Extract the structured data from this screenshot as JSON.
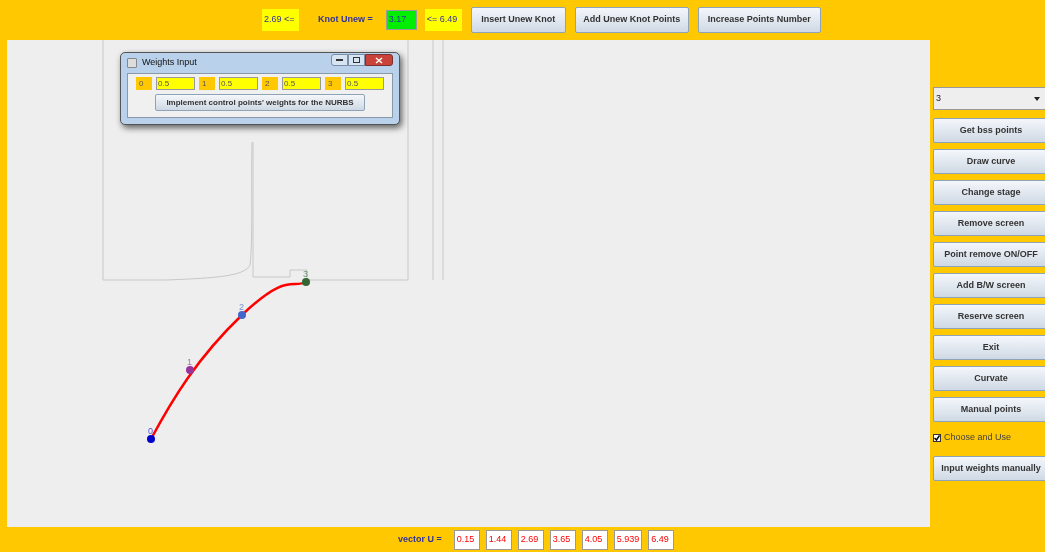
{
  "top_bar": {
    "lower_bound": "2.69 <=",
    "knot_label": "Knot Unew =",
    "knot_value": "3.17",
    "upper_bound": "<= 6.49",
    "buttons": [
      "Insert Unew Knot",
      "Add Unew Knot Points",
      "Increase Points Number"
    ]
  },
  "dialog": {
    "title": "Weights Input",
    "weights": [
      {
        "index": "0",
        "value": "0.5"
      },
      {
        "index": "1",
        "value": "0.5"
      },
      {
        "index": "2",
        "value": "0.5"
      },
      {
        "index": "3",
        "value": "0.5"
      }
    ],
    "button": "Implement control points' weights for the NURBS"
  },
  "canvas": {
    "points": [
      {
        "label": "0",
        "color": "#0000cc"
      },
      {
        "label": "1",
        "color": "#993399"
      },
      {
        "label": "2",
        "color": "#4466cc"
      },
      {
        "label": "3",
        "color": "#336633"
      }
    ]
  },
  "side_panel": {
    "dropdown": {
      "value": "3"
    },
    "items": [
      {
        "kind": "button",
        "label": "Get bss points"
      },
      {
        "kind": "button",
        "label": "Draw curve"
      },
      {
        "kind": "button",
        "label": "Change stage"
      },
      {
        "kind": "button",
        "label": "Remove screen"
      },
      {
        "kind": "button",
        "label": "Point remove ON/OFF"
      },
      {
        "kind": "button",
        "label": "Add B/W screen"
      },
      {
        "kind": "button",
        "label": "Reserve screen"
      },
      {
        "kind": "button",
        "label": "Exit"
      },
      {
        "kind": "button",
        "label": "Curvate"
      },
      {
        "kind": "button",
        "label": "Manual points"
      },
      {
        "kind": "checkbox",
        "label": "Choose and Use",
        "checked": true
      },
      {
        "kind": "button",
        "label": "Input weights manually"
      }
    ]
  },
  "bottom_bar": {
    "label": "vector U =",
    "values": [
      "0.15",
      "1.44",
      "2.69",
      "3.65",
      "4.05",
      "5.939",
      "6.49"
    ]
  }
}
